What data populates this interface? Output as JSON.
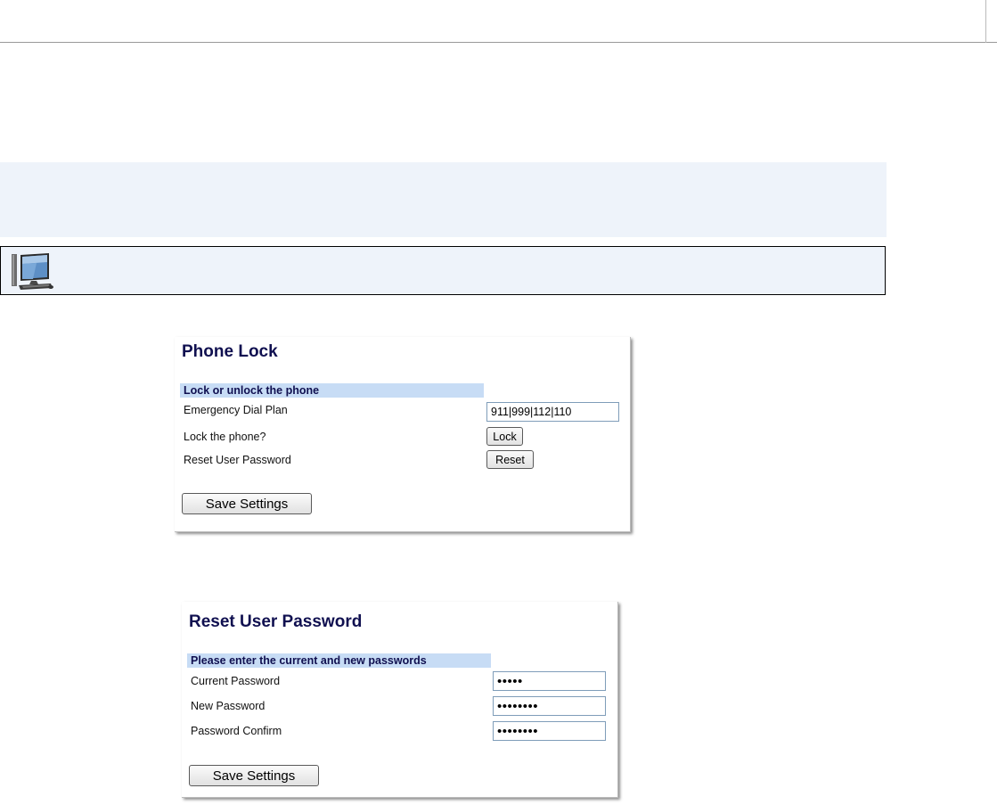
{
  "phone_lock": {
    "title": "Phone Lock",
    "section": "Lock or unlock the phone",
    "emergency_label": "Emergency Dial Plan",
    "emergency_value": "911|999|112|110",
    "lock_label": "Lock the phone?",
    "lock_button": "Lock",
    "reset_label": "Reset User Password",
    "reset_button": "Reset",
    "save_button": "Save Settings"
  },
  "reset_password": {
    "title": "Reset User Password",
    "section": "Please enter the current and new passwords",
    "current_label": "Current Password",
    "current_value": "12345",
    "new_label": "New Password",
    "new_value": "12345678",
    "confirm_label": "Password Confirm",
    "confirm_value": "12345678",
    "save_button": "Save Settings"
  },
  "tip": {
    "icon": "web-ui-computer-icon"
  },
  "colors": {
    "title_text": "#101050",
    "section_bar": "#c7dcf5",
    "note_band": "#eef3fa"
  }
}
